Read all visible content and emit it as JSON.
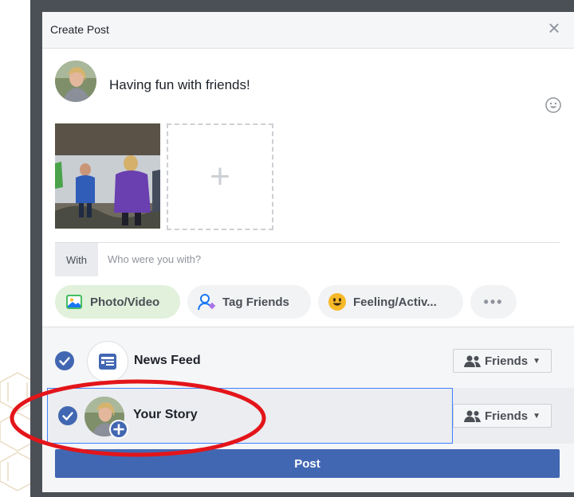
{
  "dialog": {
    "title": "Create Post",
    "close_icon": "close-icon",
    "status_text": "Having fun with friends!"
  },
  "media": {
    "add_icon": "plus-icon"
  },
  "with_row": {
    "label": "With",
    "placeholder": "Who were you with?"
  },
  "actions": [
    {
      "label": "Photo/Video",
      "icon": "photo-icon"
    },
    {
      "label": "Tag Friends",
      "icon": "tag-friends-icon"
    },
    {
      "label": "Feeling/Activ...",
      "icon": "feeling-icon"
    },
    {
      "label": "•••",
      "icon": "more-icon"
    }
  ],
  "destinations": [
    {
      "label": "News Feed",
      "privacy": "Friends",
      "checked": true
    },
    {
      "label": "Your Story",
      "privacy": "Friends",
      "checked": true
    }
  ],
  "post_button": "Post",
  "colors": {
    "brand": "#4267b2",
    "check": "#4267b2",
    "annotation": "#e3151a"
  }
}
